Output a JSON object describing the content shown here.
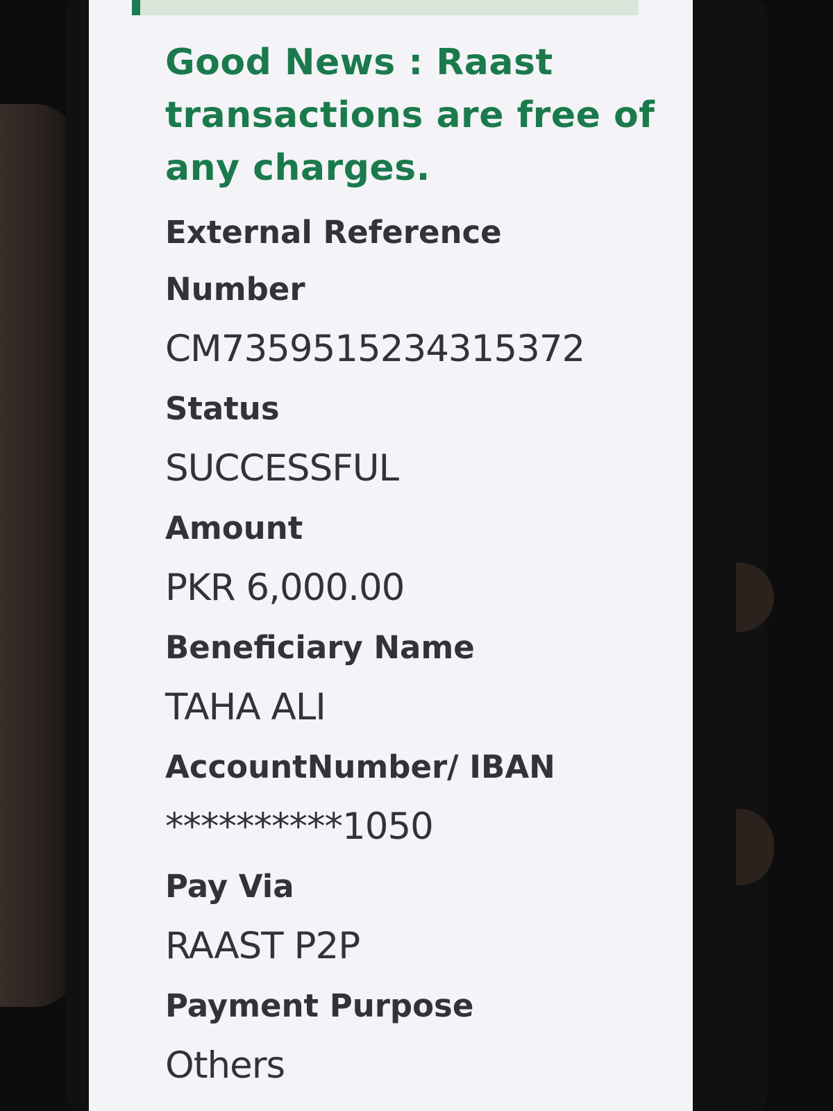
{
  "notice": {
    "text": "Good News : Raast transactions are free of any charges."
  },
  "fields": [
    {
      "label": "External Reference Number",
      "value": "CM7359515234315372"
    },
    {
      "label": "Status",
      "value": "SUCCESSFUL"
    },
    {
      "label": "Amount",
      "value": "PKR 6,000.00"
    },
    {
      "label": "Beneficiary Name",
      "value": "TAHA ALI"
    },
    {
      "label": "AccountNumber/ IBAN",
      "value": "**********1050"
    },
    {
      "label": "Pay Via",
      "value": "RAAST P2P"
    },
    {
      "label": "Payment Purpose",
      "value": "Others"
    }
  ],
  "colors": {
    "accent_green": "#1a7a4c",
    "text": "#333236",
    "screen_bg": "#f4f3f7"
  }
}
